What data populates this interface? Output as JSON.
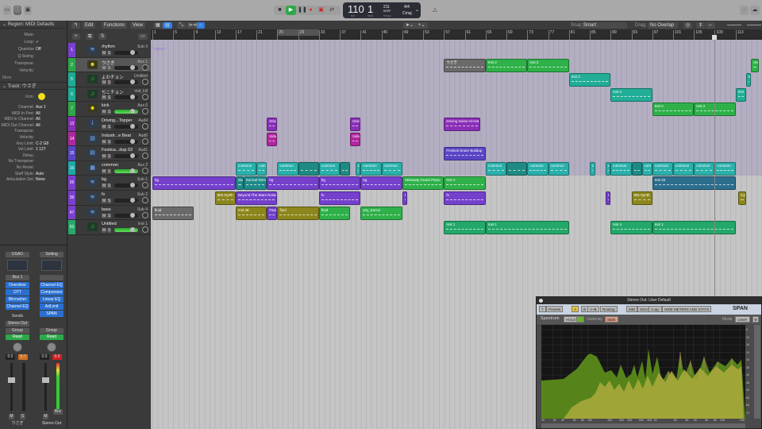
{
  "toolbar": {
    "lcd": {
      "bar": "110",
      "beat": "1",
      "bar_label": "bar",
      "beat_label": "beat",
      "tempo": "211",
      "tempo_mode": "KEEP",
      "tempo_label": "tempo",
      "signature": "4/4",
      "key": "Cmaj"
    }
  },
  "colors": {
    "accent": "#2f7de1",
    "play": "#2fa84a",
    "record": "#e03030"
  },
  "inspector": {
    "region_header": "Region: MIDI Defaults",
    "region_params": [
      {
        "k": "Mute:",
        "v": ""
      },
      {
        "k": "Loop:",
        "v": "✓"
      },
      {
        "k": "Quantize",
        "v": "Off"
      },
      {
        "k": "Q-Swing:",
        "v": ""
      },
      {
        "k": "Transpose:",
        "v": ""
      },
      {
        "k": "Velocity:",
        "v": ""
      }
    ],
    "more": "More",
    "track_header": "Track: ウさぎ",
    "icon_label": "Icon:",
    "track_params": [
      {
        "k": "Channel:",
        "v": "Aux 1"
      },
      {
        "k": "MIDI In Port:",
        "v": "All"
      },
      {
        "k": "MIDI In Channel:",
        "v": "All"
      },
      {
        "k": "MIDI Out Channel:",
        "v": "All"
      },
      {
        "k": "Transpose:",
        "v": ""
      },
      {
        "k": "Velocity:",
        "v": ""
      },
      {
        "k": "Key Limit:",
        "v": "C-2  G8"
      },
      {
        "k": "Vel Limit:",
        "v": "1  127"
      },
      {
        "k": "Delay:",
        "v": ""
      },
      {
        "k": "No Transpose:",
        "v": ""
      },
      {
        "k": "No Reset:",
        "v": ""
      },
      {
        "k": "Staff Style:",
        "v": "Auto"
      },
      {
        "k": "Articulation Set:",
        "v": "None"
      }
    ]
  },
  "mixer": [
    {
      "setting": "USAO",
      "io": "Bus 1",
      "plugins": [
        "Overdrive",
        "OTT",
        "Bitcrusher",
        "Channel EQ"
      ],
      "sends": "Sends",
      "output": "Stereo Out",
      "group": "Group",
      "automation": "Read",
      "vol": "0.0",
      "peak": "5.7",
      "peak_color": "#d07020",
      "name": "ウさぎ",
      "m": "M",
      "s": "S"
    },
    {
      "setting": "Setting",
      "io": "",
      "plugins": [
        "Channel EQ",
        "Compressor",
        "Linear EQ",
        "AdLimit",
        "SPAN"
      ],
      "sends": "",
      "output": "",
      "group": "Group",
      "automation": "Read",
      "vol": "0.0",
      "peak": "0.0",
      "peak_color": "#d02020",
      "name": "Stereo Out",
      "m": "M",
      "s": "",
      "bnc": "Bnc"
    }
  ],
  "arrange": {
    "menu": [
      "Edit",
      "Functions",
      "View"
    ],
    "snap_label": "Snap:",
    "snap": "Smart",
    "drag_label": "Drag:",
    "drag": "No Overlap",
    "add": "+",
    "s_button": "S",
    "ruler": [
      "1",
      "5",
      "9",
      "13",
      "17",
      "21",
      "25",
      "29",
      "33",
      "37",
      "41",
      "45",
      "49",
      "53",
      "57",
      "61",
      "65",
      "69",
      "73",
      "77",
      "81",
      "85",
      "89",
      "93",
      "97",
      "101",
      "105",
      "109",
      "113"
    ],
    "folder_label": "rhythm",
    "cycle": [
      25,
      33
    ],
    "playhead_bar": 109
  },
  "tracks": [
    {
      "num": "1",
      "name": "rhythm",
      "out": "Sub 3",
      "color": "#7b3fd0",
      "icon": "stack-icon"
    },
    {
      "num": "2",
      "name": "ウさぎ",
      "out": "Aux 1",
      "color": "#2ea84a",
      "icon": "smiley-icon",
      "selected": true
    },
    {
      "num": "5",
      "name": "よわチョン",
      "out": "Untitled",
      "color": "#1eab96",
      "icon": "music-note-icon"
    },
    {
      "num": "6",
      "name": "ぢこチョン",
      "out": "mid_kill",
      "color": "#1eab96",
      "icon": "music-note-icon"
    },
    {
      "num": "7",
      "name": "kick",
      "out": "Aux 6",
      "color": "#2ea84a",
      "icon": "smiley-icon",
      "meter": true
    },
    {
      "num": "13",
      "name": "Driving...Topper",
      "out": "Aud4",
      "color": "#8a2fb8",
      "icon": "microphone-icon"
    },
    {
      "num": "14",
      "name": "Industr...e Beat",
      "out": "Aud6",
      "color": "#b0279f",
      "icon": "drum-machine-icon"
    },
    {
      "num": "15",
      "name": "Festiva...dup 02",
      "out": "Aud1",
      "color": "#5a45c5",
      "icon": "drum-machine-icon"
    },
    {
      "num": "16",
      "name": "common",
      "out": "Aux 2",
      "color": "#1ea9a6",
      "icon": "track-stack-icon",
      "meter": true
    },
    {
      "num": "26",
      "name": "bg",
      "out": "Sub 1",
      "color": "#7b3fd0",
      "icon": "stack-icon"
    },
    {
      "num": "39",
      "name": "fx",
      "out": "Sub 2",
      "color": "#7b3fd0",
      "icon": "stack-icon"
    },
    {
      "num": "47",
      "name": "bass",
      "out": "Sub 4",
      "color": "#7b3fd0",
      "icon": "stack-icon"
    },
    {
      "num": "53",
      "name": "Untitled",
      "out": "Inst 1",
      "color": "#26a86c",
      "icon": "music-note-icon",
      "meter": true
    }
  ],
  "regions": [
    {
      "row": 1,
      "label": "ウさぎ",
      "start": 57,
      "end": 65,
      "color": "#6a6a6a"
    },
    {
      "row": 1,
      "label": "Inst 2",
      "start": 65,
      "end": 73,
      "color": "#2fb14a"
    },
    {
      "row": 1,
      "label": "Inst 2",
      "start": 73,
      "end": 81,
      "color": "#2fb14a"
    },
    {
      "row": 1,
      "label": "Inst",
      "start": 116,
      "end": 117.5,
      "color": "#2fb14a"
    },
    {
      "row": 2,
      "label": "Inst 2",
      "start": 81,
      "end": 89,
      "color": "#22ad97"
    },
    {
      "row": 2,
      "label": "In",
      "start": 115,
      "end": 116,
      "color": "#22ad97"
    },
    {
      "row": 3,
      "label": "Inst 2",
      "start": 89,
      "end": 97,
      "color": "#22ad97"
    },
    {
      "row": 3,
      "label": "Inst",
      "start": 113,
      "end": 115,
      "color": "#22ad97"
    },
    {
      "row": 4,
      "label": "Inst 2",
      "start": 97,
      "end": 105,
      "color": "#2fb14a"
    },
    {
      "row": 4,
      "label": "Inst 2",
      "start": 105,
      "end": 113,
      "color": "#2fb14a"
    },
    {
      "row": 5,
      "label": "Drivi",
      "start": 23,
      "end": 25,
      "color": "#8a2fb8"
    },
    {
      "row": 5,
      "label": "Drivi",
      "start": 39,
      "end": 41,
      "color": "#8a2fb8"
    },
    {
      "row": 5,
      "label": "Driving Noise Hi-Hat",
      "start": 57,
      "end": 64,
      "color": "#8a2fb8"
    },
    {
      "row": 6,
      "label": "Indus",
      "start": 23,
      "end": 25,
      "color": "#b0279f"
    },
    {
      "row": 6,
      "label": "Indus",
      "start": 39,
      "end": 41,
      "color": "#b0279f"
    },
    {
      "row": 7,
      "label": "Festival Snare Buildup",
      "start": 57,
      "end": 65,
      "color": "#5a45c5"
    },
    {
      "row": 8,
      "label": "common",
      "start": 17,
      "end": 21,
      "color": "#2ab0aa"
    },
    {
      "row": 8,
      "label": "com",
      "start": 21,
      "end": 23,
      "color": "#2ab0aa"
    },
    {
      "row": 8,
      "label": "common",
      "start": 25,
      "end": 29,
      "color": "#2ab0aa"
    },
    {
      "row": 8,
      "label": "",
      "start": 29,
      "end": 33,
      "color": "#1f8a84"
    },
    {
      "row": 8,
      "label": "common",
      "start": 33,
      "end": 37,
      "color": "#2ab0aa"
    },
    {
      "row": 8,
      "label": "",
      "start": 37,
      "end": 39,
      "color": "#1f8a84"
    },
    {
      "row": 8,
      "label": "c",
      "start": 40,
      "end": 41,
      "color": "#2ab0aa"
    },
    {
      "row": 8,
      "label": "common",
      "start": 41,
      "end": 45,
      "color": "#2ab0aa"
    },
    {
      "row": 8,
      "label": "common",
      "start": 45,
      "end": 49,
      "color": "#2ab0aa"
    },
    {
      "row": 8,
      "label": "common",
      "start": 65,
      "end": 69,
      "color": "#2ab0aa"
    },
    {
      "row": 8,
      "label": "",
      "start": 69,
      "end": 73,
      "color": "#1f8a84"
    },
    {
      "row": 8,
      "label": "common",
      "start": 73,
      "end": 77,
      "color": "#2ab0aa"
    },
    {
      "row": 8,
      "label": "common",
      "start": 77,
      "end": 81,
      "color": "#2ab0aa"
    },
    {
      "row": 8,
      "label": "c",
      "start": 85,
      "end": 86,
      "color": "#2ab0aa"
    },
    {
      "row": 8,
      "label": "c",
      "start": 88,
      "end": 89,
      "color": "#2ab0aa"
    },
    {
      "row": 8,
      "label": "common",
      "start": 89,
      "end": 93,
      "color": "#2ab0aa"
    },
    {
      "row": 8,
      "label": "",
      "start": 93,
      "end": 95,
      "color": "#1f8a84"
    },
    {
      "row": 8,
      "label": "com",
      "start": 95,
      "end": 97,
      "color": "#2ab0aa"
    },
    {
      "row": 8,
      "label": "common",
      "start": 97,
      "end": 101,
      "color": "#2ab0aa"
    },
    {
      "row": 8,
      "label": "common",
      "start": 101,
      "end": 105,
      "color": "#2ab0aa"
    },
    {
      "row": 8,
      "label": "common",
      "start": 105,
      "end": 109,
      "color": "#2ab0aa"
    },
    {
      "row": 8,
      "label": "common",
      "start": 109,
      "end": 113,
      "color": "#2ab0aa"
    },
    {
      "row": 9,
      "label": "bg",
      "start": 1,
      "end": 17,
      "color": "#7440cc"
    },
    {
      "row": 9,
      "label": "Sur",
      "start": 17,
      "end": 18.5,
      "color": "#1f8a8a"
    },
    {
      "row": 9,
      "label": "Surreal Rem",
      "start": 18.5,
      "end": 23,
      "color": "#1f8a8a"
    },
    {
      "row": 9,
      "label": "bg",
      "start": 23,
      "end": 33,
      "color": "#7440cc"
    },
    {
      "row": 9,
      "label": "bg",
      "start": 33,
      "end": 41,
      "color": "#7440cc"
    },
    {
      "row": 9,
      "label": "bg",
      "start": 41,
      "end": 49,
      "color": "#7440cc"
    },
    {
      "row": 9,
      "label": "Steinway Grand Piano",
      "start": 49,
      "end": 57,
      "color": "#2fb14a"
    },
    {
      "row": 9,
      "label": "Inst 4",
      "start": 57,
      "end": 65,
      "color": "#2fb14a"
    },
    {
      "row": 9,
      "label": "Inst 20",
      "start": 97,
      "end": 113,
      "color": "#2c6e8e"
    },
    {
      "row": 10,
      "label": "80s Synth",
      "start": 13,
      "end": 17,
      "color": "#8c861c"
    },
    {
      "row": 10,
      "label": "Beyond The Stars Noise",
      "start": 17,
      "end": 25,
      "color": "#7440cc"
    },
    {
      "row": 10,
      "label": "fx",
      "start": 33,
      "end": 41,
      "color": "#7440cc"
    },
    {
      "row": 10,
      "label": "I",
      "start": 49,
      "end": 50,
      "color": "#7440cc"
    },
    {
      "row": 10,
      "label": "fx",
      "start": 57,
      "end": 65,
      "color": "#7440cc"
    },
    {
      "row": 10,
      "label": "I",
      "start": 88,
      "end": 89,
      "color": "#7440cc"
    },
    {
      "row": 10,
      "label": "80s Synth",
      "start": 93,
      "end": 97,
      "color": "#8c861c"
    },
    {
      "row": 10,
      "label": "Cym",
      "start": 113.5,
      "end": 115,
      "color": "#8c861c"
    },
    {
      "row": 11,
      "label": "fluid",
      "start": 1,
      "end": 9,
      "color": "#6a6a6a"
    },
    {
      "row": 11,
      "label": "Inst 28",
      "start": 17,
      "end": 23,
      "color": "#8c861c"
    },
    {
      "row": 11,
      "label": "Fast",
      "start": 23,
      "end": 25,
      "color": "#7440cc"
    },
    {
      "row": 11,
      "label": "fluid",
      "start": 25,
      "end": 33,
      "color": "#8c861c"
    },
    {
      "row": 11,
      "label": "fluid",
      "start": 33,
      "end": 39,
      "color": "#2fb14a"
    },
    {
      "row": 11,
      "label": "psy_trance",
      "start": 41,
      "end": 49,
      "color": "#2fb14a"
    },
    {
      "row": 12,
      "label": "Inst 1",
      "start": 57,
      "end": 65,
      "color": "#23a86a"
    },
    {
      "row": 12,
      "label": "Inst 1",
      "start": 65,
      "end": 81,
      "color": "#23a86a"
    },
    {
      "row": 12,
      "label": "Inst 4",
      "start": 89,
      "end": 97,
      "color": "#23a86a"
    },
    {
      "row": 12,
      "label": "Inst 1",
      "start": 97,
      "end": 113,
      "color": "#23a86a"
    }
  ],
  "plugin": {
    "title": "Stereo Out: User Default",
    "buttons": [
      "?",
      "Presets",
      "A",
      "B",
      "A+B",
      "Routing",
      "MID",
      "SOLO",
      "Copy",
      "HIDE METERS AND STATS"
    ],
    "brand": "SPAN",
    "spectrum_label": "Spectrum",
    "hold": "HOLD",
    "underlay_label": "Underlay",
    "underlay": "SIDE",
    "mode_label": "Mode",
    "mode": "USER",
    "freq_labels": [
      "20",
      "30",
      "40",
      "60",
      "80",
      "100",
      "200",
      "300",
      "400",
      "600",
      "800",
      "1K",
      "2K",
      "3K",
      "4K",
      "6K",
      "8K",
      "10K",
      "20K"
    ],
    "db_labels": [
      "6",
      "12",
      "18",
      "24",
      "30",
      "36",
      "42",
      "48",
      "54",
      "60",
      "66",
      "72"
    ]
  }
}
